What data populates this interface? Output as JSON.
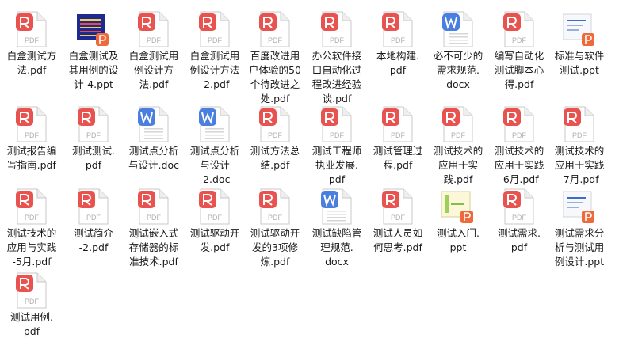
{
  "files": [
    {
      "name": "白盒测试方\n法.pdf",
      "type": "pdf"
    },
    {
      "name": "白盒测试及\n其用例的设\n计-4.ppt",
      "type": "ppt-thumb-blue"
    },
    {
      "name": "白盒测试用\n例设计方\n法.pdf",
      "type": "pdf"
    },
    {
      "name": "白盒测试用\n例设计方法\n-2.pdf",
      "type": "pdf"
    },
    {
      "name": "百度改进用\n户体验的50\n个待改进之\n处.pdf",
      "type": "pdf"
    },
    {
      "name": "办公软件接\n口自动化过\n程改进经验\n谈.pdf",
      "type": "pdf"
    },
    {
      "name": "本地构建.\npdf",
      "type": "pdf"
    },
    {
      "name": "必不可少的\n需求规范.\ndocx",
      "type": "doc"
    },
    {
      "name": "编写自动化\n测试脚本心\n得.pdf",
      "type": "pdf"
    },
    {
      "name": "标准与软件\n测试.ppt",
      "type": "ppt-thumb-white"
    },
    {
      "name": "测试报告编\n写指南.pdf",
      "type": "pdf"
    },
    {
      "name": "测试测试.\npdf",
      "type": "pdf"
    },
    {
      "name": "测试点分析\n与设计.doc",
      "type": "doc"
    },
    {
      "name": "测试点分析\n与设计\n-2.doc",
      "type": "doc"
    },
    {
      "name": "测试方法总\n结.pdf",
      "type": "pdf"
    },
    {
      "name": "测试工程师\n执业发展.\npdf",
      "type": "pdf"
    },
    {
      "name": "测试管理过\n程.pdf",
      "type": "pdf"
    },
    {
      "name": "测试技术的\n应用于实\n践.pdf",
      "type": "pdf"
    },
    {
      "name": "测试技术的\n应用于实践\n-6月.pdf",
      "type": "pdf"
    },
    {
      "name": "测试技术的\n应用于实践\n-7月.pdf",
      "type": "pdf"
    },
    {
      "name": "测试技术的\n应用与实践\n-5月.pdf",
      "type": "pdf"
    },
    {
      "name": "测试简介\n-2.pdf",
      "type": "pdf"
    },
    {
      "name": "测试嵌入式\n存储器的标\n准技术.pdf",
      "type": "pdf"
    },
    {
      "name": "测试驱动开\n发.pdf",
      "type": "pdf"
    },
    {
      "name": "测试驱动开\n发的3项修\n炼.pdf",
      "type": "pdf"
    },
    {
      "name": "测试缺陷管\n理规范.\ndocx",
      "type": "doc"
    },
    {
      "name": "测试人员如\n何思考.pdf",
      "type": "pdf"
    },
    {
      "name": "测试入门.\nppt",
      "type": "ppt-thumb-yellow"
    },
    {
      "name": "测试需求.\npdf",
      "type": "pdf"
    },
    {
      "name": "测试需求分\n析与测试用\n例设计.ppt",
      "type": "ppt-thumb-white2"
    },
    {
      "name": "测试用例.\npdf",
      "type": "pdf"
    }
  ],
  "icons": {
    "pdf_label": "PDF",
    "pdf_color": "#e8524f",
    "doc_color": "#4a7fe0",
    "ppt_color": "#ef6a3b"
  }
}
